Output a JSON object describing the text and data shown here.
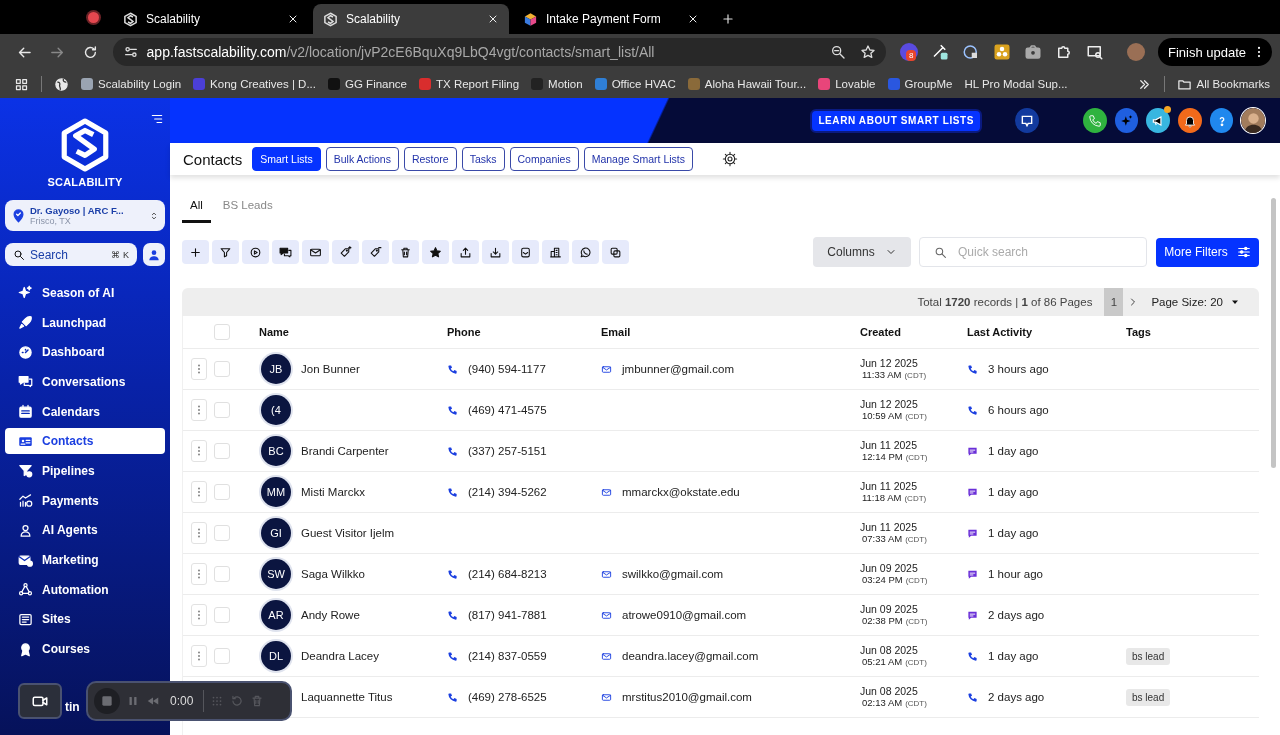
{
  "browser": {
    "tabs": [
      {
        "title": "Scalability",
        "selected": false
      },
      {
        "title": "Scalability",
        "selected": true
      },
      {
        "title": "Intake Payment Form",
        "selected": false
      }
    ],
    "url_host": "app.fastscalability.com",
    "url_path": "/v2/location/jvP2cE6BquXq9LbQ4vgt/contacts/smart_list/All",
    "extension_badge": "8",
    "update_button": "Finish update",
    "bookmarks": [
      "Scalability Login",
      "Kong Creatives | D...",
      "GG Finance",
      "TX Report Filing",
      "Motion",
      "Office HVAC",
      "Aloha Hawaii Tour...",
      "Lovable",
      "GroupMe",
      "HL Pro Modal Sup..."
    ],
    "all_bookmarks": "All Bookmarks"
  },
  "sidebar": {
    "brand": "SCALABILITY",
    "location": {
      "name": "Dr. Gayoso | ARC F...",
      "city": "Frisco, TX"
    },
    "search": {
      "placeholder": "Search",
      "shortcut": "⌘ K"
    },
    "items": [
      {
        "label": "Season of AI",
        "selected": false
      },
      {
        "label": "Launchpad",
        "selected": false
      },
      {
        "label": "Dashboard",
        "selected": false
      },
      {
        "label": "Conversations",
        "selected": false
      },
      {
        "label": "Calendars",
        "selected": false
      },
      {
        "label": "Contacts",
        "selected": true
      },
      {
        "label": "Pipelines",
        "selected": false
      },
      {
        "label": "Payments",
        "selected": false
      },
      {
        "label": "AI Agents",
        "selected": false
      },
      {
        "label": "Marketing",
        "selected": false
      },
      {
        "label": "Automation",
        "selected": false
      },
      {
        "label": "Sites",
        "selected": false
      },
      {
        "label": "Courses",
        "selected": false
      }
    ],
    "bottom_item": "tin"
  },
  "header": {
    "learn_button": "LEARN ABOUT SMART LISTS",
    "notification_dot": true
  },
  "contacts": {
    "title": "Contacts",
    "buttons": [
      {
        "label": "Smart Lists",
        "selected": true
      },
      {
        "label": "Bulk Actions",
        "selected": false
      },
      {
        "label": "Restore",
        "selected": false
      },
      {
        "label": "Tasks",
        "selected": false
      },
      {
        "label": "Companies",
        "selected": false
      },
      {
        "label": "Manage Smart Lists",
        "selected": false
      }
    ],
    "tabs": [
      {
        "label": "All",
        "selected": true
      },
      {
        "label": "BS Leads",
        "selected": false
      }
    ],
    "columns_button": "Columns",
    "quick_search": {
      "placeholder": "Quick search"
    },
    "filters_button": "More Filters",
    "pagination": {
      "summary": "Total **1720** records | **1** of 86 Pages",
      "page": "1",
      "page_size": "Page Size: 20"
    },
    "table": {
      "select_all_checked": false,
      "columns": [
        "Name",
        "Phone",
        "Email",
        "Created",
        "Last Activity",
        "Tags"
      ],
      "rows": [
        {
          "initials": "JB",
          "name": "Jon Bunner",
          "phone": "(940) 594-1177",
          "email": "jmbunner@gmail.com",
          "created_date": "Jun 12 2025",
          "created_time": "11:33 AM",
          "timezone": "(CDT)",
          "kind": "call",
          "last_activity": "3 hours ago",
          "checked": false
        },
        {
          "initials": "(4",
          "phone": "(469) 471-4575",
          "created_date": "Jun 12 2025",
          "created_time": "10:59 AM",
          "timezone": "(CDT)",
          "kind": "call",
          "last_activity": "6 hours ago",
          "checked": false
        },
        {
          "initials": "BC",
          "name": "Brandi Carpenter",
          "phone": "(337) 257-5151",
          "created_date": "Jun 11 2025",
          "created_time": "12:14 PM",
          "timezone": "(CDT)",
          "kind": "sms",
          "last_activity": "1 day ago",
          "checked": false
        },
        {
          "initials": "MM",
          "name": "Misti Marckx",
          "phone": "(214) 394-5262",
          "email": "mmarckx@okstate.edu",
          "created_date": "Jun 11 2025",
          "created_time": "11:18 AM",
          "timezone": "(CDT)",
          "kind": "sms",
          "last_activity": "1 day ago",
          "checked": false
        },
        {
          "initials": "GI",
          "name": "Guest Visitor Ijelm",
          "created_date": "Jun 11 2025",
          "created_time": "07:33 AM",
          "timezone": "(CDT)",
          "kind": "sms",
          "last_activity": "1 day ago",
          "checked": false
        },
        {
          "initials": "SW",
          "name": "Saga Wilkko",
          "phone": "(214) 684-8213",
          "email": "swilkko@gmail.com",
          "created_date": "Jun 09 2025",
          "created_time": "03:24 PM",
          "timezone": "(CDT)",
          "kind": "sms",
          "last_activity": "1 hour ago",
          "checked": false
        },
        {
          "initials": "AR",
          "name": "Andy Rowe",
          "phone": "(817) 941-7881",
          "email": "atrowe0910@gmail.com",
          "created_date": "Jun 09 2025",
          "created_time": "02:38 PM",
          "timezone": "(CDT)",
          "kind": "sms",
          "last_activity": "2 days ago",
          "checked": false
        },
        {
          "initials": "DL",
          "name": "Deandra Lacey",
          "phone": "(214) 837-0559",
          "email": "deandra.lacey@gmail.com",
          "created_date": "Jun 08 2025",
          "created_time": "05:21 AM",
          "timezone": "(CDT)",
          "kind": "call",
          "last_activity": "1 day ago",
          "tags": [
            "bs lead"
          ],
          "checked": false
        },
        {
          "name": "Laquannette Titus",
          "phone": "(469) 278-6525",
          "email": "mrstitus2010@gmail.com",
          "created_date": "Jun 08 2025",
          "created_time": "02:13 AM",
          "timezone": "(CDT)",
          "kind": "call",
          "last_activity": "2 days ago",
          "tags": [
            "bs lead"
          ]
        }
      ]
    }
  },
  "recorder": {
    "time": "0:00"
  }
}
